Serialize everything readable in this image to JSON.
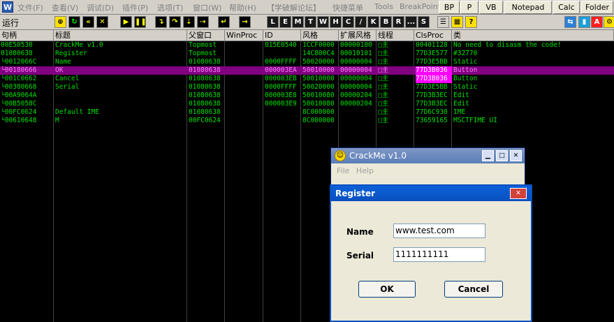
{
  "menubar": {
    "items": [
      "文件(F)",
      "查看(V)",
      "调试(D)",
      "插件(P)",
      "选项(T)",
      "窗口(W)",
      "帮助(H)",
      "【学破解论坛】",
      "快捷菜单",
      "Tools",
      "BreakPoint"
    ],
    "buttons": [
      "BP",
      "P",
      "VB",
      "Notepad",
      "Calc",
      "Folder"
    ]
  },
  "toolbar": {
    "run_label": "运行",
    "letters": [
      "L",
      "E",
      "M",
      "T",
      "W",
      "H",
      "C",
      "/",
      "K",
      "B",
      "R",
      "...",
      "S"
    ]
  },
  "columns": [
    "句柄",
    "标题",
    "父窗口",
    "WinProc",
    "ID",
    "风格",
    "扩展风格",
    "线程",
    "ClsProc",
    "类"
  ],
  "rows": [
    {
      "handle": "00E50530",
      "title": "CrackMe v1.0",
      "parent": "Topmost",
      "winproc": "",
      "id": "015E0540",
      "style": "1CCF0000",
      "exstyle": "00000100",
      "thread": "□主",
      "clsproc": "00401128",
      "cls": "No need to disasm the code!"
    },
    {
      "handle": "01080638",
      "title": "Register",
      "parent": "Topmost",
      "winproc": "",
      "id": "",
      "style": "14C800C4",
      "exstyle": "00010101",
      "thread": "□主",
      "clsproc": "77D3E577",
      "cls": "#32770"
    },
    {
      "handle": "└0012066C",
      "title": "Name",
      "parent": "01080638",
      "winproc": "",
      "id": "0000FFFF",
      "style": "50020000",
      "exstyle": "00000004",
      "thread": "□主",
      "clsproc": "77D3E5BB",
      "cls": "Static"
    },
    {
      "handle": "└00180666",
      "title": "OK",
      "parent": "01080638",
      "winproc": "",
      "id": "000003EA",
      "style": "50010000",
      "exstyle": "00000004",
      "thread": "□主",
      "clsproc": "77D3B036",
      "cls": "Button"
    },
    {
      "handle": "└001C0662",
      "title": "Cancel",
      "parent": "01080638",
      "winproc": "",
      "id": "000003EB",
      "style": "50010000",
      "exstyle": "00000004",
      "thread": "□主",
      "clsproc": "77D3B036",
      "cls": "Button"
    },
    {
      "handle": "└00380668",
      "title": "Serial",
      "parent": "01080638",
      "winproc": "",
      "id": "0000FFFF",
      "style": "50020000",
      "exstyle": "00000004",
      "thread": "□主",
      "clsproc": "77D3E5BB",
      "cls": "Static"
    },
    {
      "handle": "└00A9064A",
      "title": "",
      "parent": "01080638",
      "winproc": "",
      "id": "000003E8",
      "style": "50010080",
      "exstyle": "00000204",
      "thread": "□主",
      "clsproc": "77D3B3EC",
      "cls": "Edit"
    },
    {
      "handle": "└00B5058C",
      "title": "",
      "parent": "01080638",
      "winproc": "",
      "id": "000003E9",
      "style": "50010080",
      "exstyle": "00000204",
      "thread": "□主",
      "clsproc": "77D3B3EC",
      "cls": "Edit"
    },
    {
      "handle": "└00FC0624",
      "title": "Default IME",
      "parent": "01080638",
      "winproc": "",
      "id": "",
      "style": "8C000000",
      "exstyle": "",
      "thread": "□主",
      "clsproc": "77D6C930",
      "cls": "IME"
    },
    {
      "handle": "  └00610648",
      "title": "M",
      "parent": "00FC0624",
      "winproc": "",
      "id": "",
      "style": "8C000000",
      "exstyle": "",
      "thread": "□主",
      "clsproc": "73659165",
      "cls": "MSCTFIME UI"
    }
  ],
  "crackme": {
    "title": "CrackMe v1.0",
    "menu": [
      "File",
      "Help"
    ]
  },
  "register": {
    "title": "Register",
    "name_label": "Name",
    "name_value": "www.test.com",
    "serial_label": "Serial",
    "serial_value": "1111111111",
    "ok_label": "OK",
    "cancel_label": "Cancel"
  }
}
